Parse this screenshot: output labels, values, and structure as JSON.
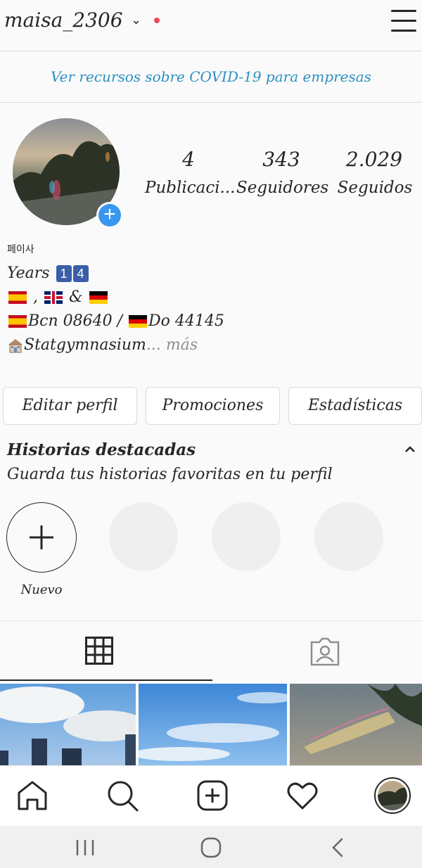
{
  "header": {
    "username": "maisa_2306",
    "chevron": "⌄"
  },
  "covid_banner": {
    "text": "Ver recursos sobre COVID-19 para empresas"
  },
  "stats": [
    {
      "value": "4",
      "label": "Publicaci..."
    },
    {
      "value": "343",
      "label": "Seguidores"
    },
    {
      "value": "2.029",
      "label": "Seguidos"
    }
  ],
  "bio": {
    "name": "페이사",
    "line1": "Years",
    "keycap_1": "1",
    "keycap_2": "4",
    "line2_sep1": ",",
    "line2_sep2": "&",
    "line3_a": "Bcn 08640 /",
    "line3_b": "Do 44145",
    "line4": "Statgymnasium",
    "more": "... más"
  },
  "buttons": {
    "edit": "Editar perfil",
    "promos": "Promociones",
    "stats": "Estadísticas"
  },
  "highlights": {
    "title": "Historias destacadas",
    "subtitle": "Guarda tus historias favoritas en tu perfil",
    "new_label": "Nuevo",
    "new_symbol": "+"
  },
  "icons": [
    "chevron-down-icon",
    "menu-icon",
    "plus-icon",
    "grid-icon",
    "tagged-icon",
    "home-icon",
    "search-icon",
    "add-post-icon",
    "heart-icon",
    "profile-avatar-icon",
    "recents-icon",
    "home-circle-icon",
    "back-icon",
    "school-icon"
  ],
  "colors": {
    "link": "#2a90c2",
    "accent": "#3897f0",
    "notification": "#ed4956"
  }
}
